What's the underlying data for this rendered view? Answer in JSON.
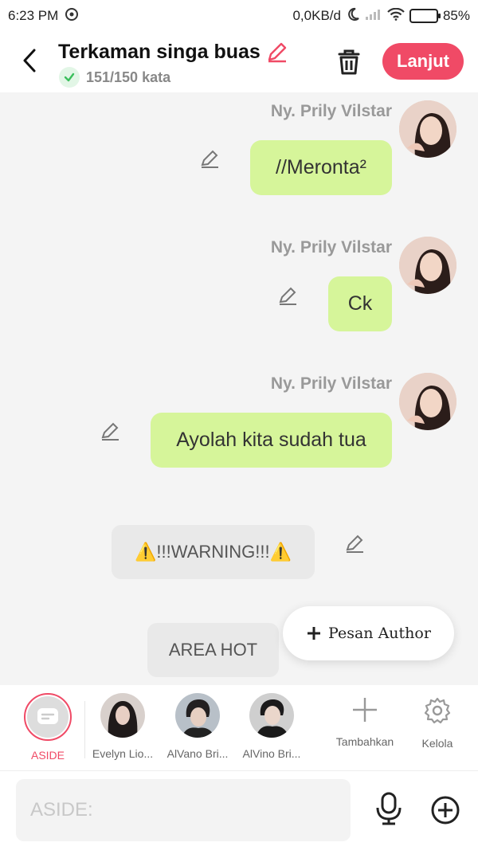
{
  "status_bar": {
    "time": "6:23 PM",
    "net_speed": "0,0KB/d",
    "battery": "85%",
    "battery_level": 0.85
  },
  "header": {
    "title": "Terkaman singa buas",
    "word_count": "151/150 kata",
    "next_label": "Lanjut"
  },
  "messages": [
    {
      "sender": "Ny. Prily Vilstar",
      "text": "//Meronta²"
    },
    {
      "sender": "Ny. Prily Vilstar",
      "text": "Ck"
    },
    {
      "sender": "Ny. Prily Vilstar",
      "text": "Ayolah kita sudah tua"
    }
  ],
  "notes": [
    {
      "text": "⚠️!!!WARNING!!!⚠️"
    },
    {
      "text": "AREA HOT"
    }
  ],
  "fab": {
    "label": "Pesan Author"
  },
  "characters": [
    {
      "label": "ASIDE",
      "active": true
    },
    {
      "label": "Evelyn Lio..."
    },
    {
      "label": "AlVano Bri..."
    },
    {
      "label": "AlVino Bri..."
    }
  ],
  "tools": [
    {
      "label": "Tambahkan",
      "icon": "plus-icon"
    },
    {
      "label": "Kelola",
      "icon": "gear-icon"
    }
  ],
  "input": {
    "placeholder": "ASIDE:"
  },
  "colors": {
    "accent": "#f04a66",
    "bubble": "#d6f59a",
    "note": "#e9e9e9"
  }
}
